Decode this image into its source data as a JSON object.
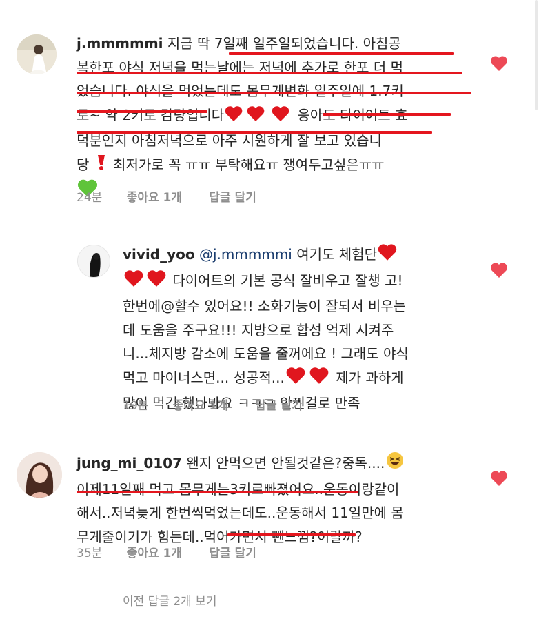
{
  "comments": [
    {
      "username": "j.mmmmmi",
      "lines": [
        "지금 딱 7일째 일주일되었습니다. 아침공",
        "복한포 야식 저녁을 먹는날에는 저녁에 추가로 한포 더 먹",
        "었습니다. 야식을 먹었는데도 몸무게변화 일주일에 1.7키",
        "로~ 약 2키로 감량입니다",
        "응아도 다이어트 효",
        "덕분인지 아침저녁으로 아주 시원하게 잘 보고 있습니",
        "당",
        "최저가로 꼭 ㅠㅠ 부탁해요ㅠ 쟁여두고싶은ㅠㅠ"
      ],
      "time": "24분",
      "likes": "좋아요 1개",
      "reply": "답글 달기"
    },
    {
      "username": "vivid_yoo",
      "mention": "@j.mmmmmi",
      "lines": [
        "여기도 체험단",
        "다이어트의 기본 공식 잘비우고 잘챙 고!",
        "한번에@할수 있어요!! 소화기능이 잘되서 비우는",
        "데 도움을 주구요!!! 지방으로 합성 억제 시켜주",
        "니...체지방 감소에 도움을 줄꺼에요 ! 그래도 야식",
        "먹고 마이너스면... 성공적...",
        "제가 과하게",
        "많이 먹긴 했나봐요 ㅋㅋㅋ 안찐걸로 만족"
      ],
      "time": "19분",
      "likes": "좋아요 1개",
      "reply": "답글 달기"
    },
    {
      "username": "jung_mi_0107",
      "lines": [
        "왠지 안먹으면 안될것같은?중독....",
        "이제11일째 먹고 몸무게는3키로빠졌어요..운동이랑같이",
        "해서..저녁늦게 한번씩먹었는데도..운동해서 11일만에 몸",
        "무게줄이기가 힘든데..먹어가면서 뺀느낌?이랄까?"
      ],
      "time": "35분",
      "likes": "좋아요 1개",
      "reply": "답글 달기"
    }
  ],
  "view_replies": "이전 답글 2개 보기",
  "colors": {
    "heart": "#ed4956",
    "underline": "#e4161e",
    "meta": "#8e8e8e",
    "text": "#262626"
  },
  "icons": [
    "heart-icon",
    "red-heart-emoji",
    "exclamation-emoji",
    "green-heart-emoji",
    "laughing-emoji"
  ]
}
